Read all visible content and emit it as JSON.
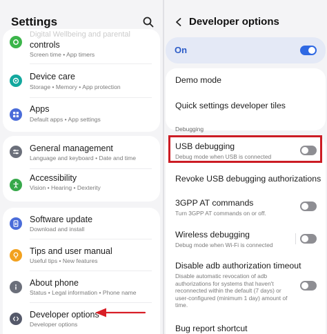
{
  "left": {
    "title": "Settings",
    "rows": [
      {
        "title": "controls",
        "subtitle": "Screen time  •  App timers",
        "icon": "leaf-icon",
        "color": "#3bb54a"
      },
      {
        "title": "Device care",
        "subtitle": "Storage  •  Memory  •  App protection",
        "icon": "device-care-icon",
        "color": "#13a89e"
      },
      {
        "title": "Apps",
        "subtitle": "Default apps  •  App settings",
        "icon": "apps-icon",
        "color": "#4a6cd9"
      },
      {
        "title": "General management",
        "subtitle": "Language and keyboard  •  Date and time",
        "icon": "sliders-icon",
        "color": "#6b6f7a"
      },
      {
        "title": "Accessibility",
        "subtitle": "Vision  •  Hearing  •  Dexterity",
        "icon": "accessibility-icon",
        "color": "#37a84a"
      },
      {
        "title": "Software update",
        "subtitle": "Download and install",
        "icon": "update-icon",
        "color": "#4a6cd9"
      },
      {
        "title": "Tips and user manual",
        "subtitle": "Useful tips  •  New features",
        "icon": "lightbulb-icon",
        "color": "#f2a11f"
      },
      {
        "title": "About phone",
        "subtitle": "Status  •  Legal information  •  Phone name",
        "icon": "info-icon",
        "color": "#6b6f7a"
      },
      {
        "title": "Developer options",
        "subtitle": "Developer options",
        "icon": "developer-icon",
        "color": "#55596a"
      }
    ],
    "cut_text": "Digital Wellbeing and parental"
  },
  "right": {
    "title": "Developer options",
    "master_toggle": {
      "label": "On",
      "state": true
    },
    "demo_mode": "Demo mode",
    "quick_tiles": "Quick settings developer tiles",
    "section": "Debugging",
    "items": [
      {
        "title": "USB debugging",
        "subtitle": "Debug mode when USB is connected",
        "toggle": false
      },
      {
        "title": "Revoke USB debugging authorizations",
        "subtitle": ""
      },
      {
        "title": "3GPP AT commands",
        "subtitle": "Turn 3GPP AT commands on or off.",
        "toggle": false
      },
      {
        "title": "Wireless debugging",
        "subtitle": "Debug mode when Wi-Fi is connected",
        "toggle": false
      },
      {
        "title": "Disable adb authorization timeout",
        "subtitle": "Disable automatic revocation of adb authorizations for systems that haven't reconnected within the default (7 days) or user-configured (minimum 1 day) amount of time.",
        "toggle": false
      },
      {
        "title": "Bug report shortcut",
        "subtitle": ""
      }
    ]
  },
  "colors": {
    "accent": "#2e68e3",
    "highlight": "#cc1c24",
    "arrow": "#d81e26"
  }
}
